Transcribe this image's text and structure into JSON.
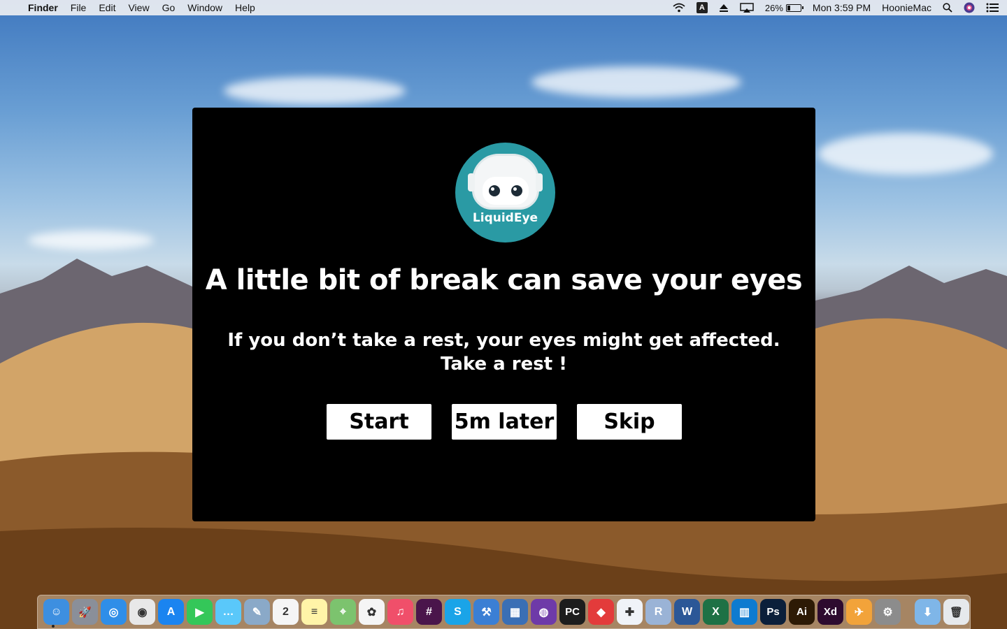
{
  "menubar": {
    "apple_glyph": "",
    "app_name": "Finder",
    "menus": [
      "File",
      "Edit",
      "View",
      "Go",
      "Window",
      "Help"
    ],
    "input_source": "A",
    "battery_percent": "26%",
    "battery_level": 0.26,
    "clock": "Mon 3:59 PM",
    "user": "HoonieMac"
  },
  "dialog": {
    "logo_text": "LiquidEye",
    "headline": "A little bit of break can save your eyes",
    "message_line1": "If you don’t take a rest, your eyes might get affected.",
    "message_line2": "Take a rest !",
    "buttons": {
      "start": "Start",
      "later": "5m later",
      "skip": "Skip"
    }
  },
  "dock": {
    "apps": [
      {
        "name": "finder-icon",
        "color": "#3d8fe0",
        "glyph": "☺"
      },
      {
        "name": "launchpad-icon",
        "color": "#8a8f99",
        "glyph": "🚀"
      },
      {
        "name": "safari-icon",
        "color": "#2f8ee8",
        "glyph": "◎"
      },
      {
        "name": "chrome-icon",
        "color": "#e8e8e8",
        "glyph": "◉"
      },
      {
        "name": "app-store-icon",
        "color": "#1a84f0",
        "glyph": "A"
      },
      {
        "name": "facetime-icon",
        "color": "#34c759",
        "glyph": "▶"
      },
      {
        "name": "messages-icon",
        "color": "#5ac8fa",
        "glyph": "…"
      },
      {
        "name": "preview-icon",
        "color": "#8aa9c8",
        "glyph": "✎"
      },
      {
        "name": "calendar-icon",
        "color": "#f5f5f5",
        "glyph": "2"
      },
      {
        "name": "notes-icon",
        "color": "#fff4a8",
        "glyph": "≡"
      },
      {
        "name": "maps-icon",
        "color": "#7cc36e",
        "glyph": "⌖"
      },
      {
        "name": "photos-icon",
        "color": "#f5f5f5",
        "glyph": "✿"
      },
      {
        "name": "music-icon",
        "color": "#f04f6a",
        "glyph": "♫"
      },
      {
        "name": "slack-icon",
        "color": "#4a154b",
        "glyph": "#"
      },
      {
        "name": "skype-icon",
        "color": "#1aa4e8",
        "glyph": "S"
      },
      {
        "name": "xcode-icon",
        "color": "#3b7fd4",
        "glyph": "⚒"
      },
      {
        "name": "simulator-icon",
        "color": "#3a6fb5",
        "glyph": "▦"
      },
      {
        "name": "github-icon",
        "color": "#6e3aa8",
        "glyph": "◍"
      },
      {
        "name": "pycharm-icon",
        "color": "#1d1d1d",
        "glyph": "PC"
      },
      {
        "name": "git-icon",
        "color": "#e33b3b",
        "glyph": "◆"
      },
      {
        "name": "tableau-icon",
        "color": "#f0f3f8",
        "glyph": "✚"
      },
      {
        "name": "r-icon",
        "color": "#9ab3d6",
        "glyph": "R"
      },
      {
        "name": "word-icon",
        "color": "#2b5797",
        "glyph": "W"
      },
      {
        "name": "excel-icon",
        "color": "#1e7145",
        "glyph": "X"
      },
      {
        "name": "azure-data-studio-icon",
        "color": "#0e7bd0",
        "glyph": "▥"
      },
      {
        "name": "photoshop-icon",
        "color": "#0b1f3a",
        "glyph": "Ps"
      },
      {
        "name": "illustrator-icon",
        "color": "#2d1a05",
        "glyph": "Ai"
      },
      {
        "name": "xd-icon",
        "color": "#2e0b2f",
        "glyph": "Xd"
      },
      {
        "name": "transmit-icon",
        "color": "#f2a33a",
        "glyph": "✈"
      },
      {
        "name": "system-preferences-icon",
        "color": "#8c8c8c",
        "glyph": "⚙"
      }
    ],
    "right_items": [
      {
        "name": "downloads-folder-icon",
        "color": "#7fb6e8",
        "glyph": "⬇"
      },
      {
        "name": "trash-icon",
        "color": "#e6e9ec",
        "glyph": "🗑"
      }
    ]
  }
}
